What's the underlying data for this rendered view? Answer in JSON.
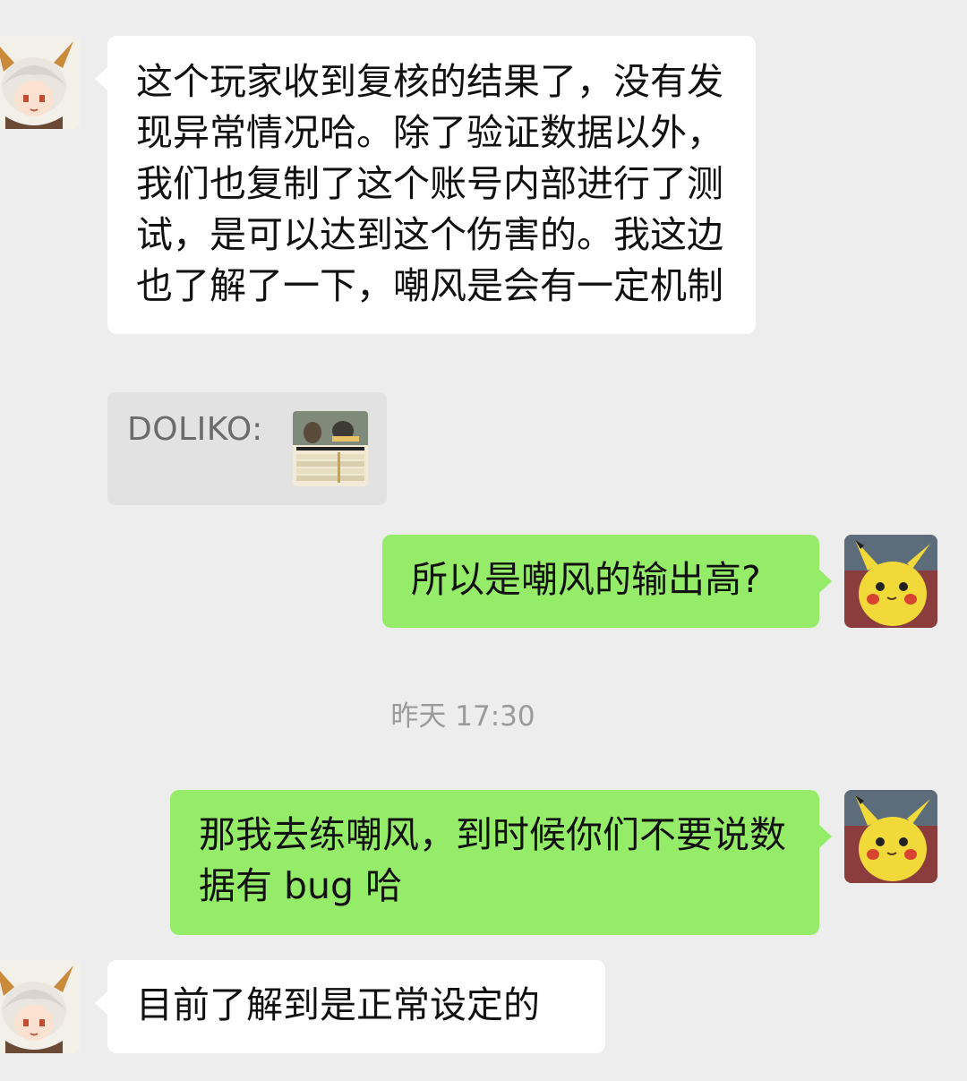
{
  "messages": {
    "m1": {
      "sender": "other",
      "text": "这个玩家收到复核的结果了，没有发现异常情况哈。除了验证数据以外，我们也复制了这个账号内部进行了测试，是可以达到这个伤害的。我这边也了解了一下，嘲风是会有一定机制"
    },
    "quote": {
      "label": "DOLIKO:",
      "thumbnail_icon": "game-screenshot-thumbnail"
    },
    "m2": {
      "sender": "me",
      "text": "所以是嘲风的输出高?"
    },
    "timestamp": "昨天 17:30",
    "m3": {
      "sender": "me",
      "text": "那我去练嘲风，到时候你们不要说数据有 bug 哈"
    },
    "m4": {
      "sender": "other",
      "text": "目前了解到是正常设定的"
    }
  },
  "colors": {
    "background": "#ededed",
    "bubble_other": "#ffffff",
    "bubble_me": "#95ec69",
    "quote_bg": "#e2e2e2",
    "timestamp_text": "#9a9a9a"
  },
  "avatars": {
    "other": "anime-character-avatar",
    "me": "pikachu-plush-avatar"
  }
}
